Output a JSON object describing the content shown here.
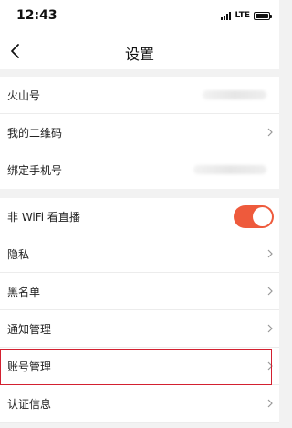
{
  "status_bar": {
    "time": "12:43",
    "network": "LTE",
    "icons": [
      "signal-icon",
      "battery-icon"
    ]
  },
  "nav": {
    "title": "设置",
    "back_icon": "chevron-left-icon"
  },
  "group1": {
    "rows": [
      {
        "label": "火山号"
      },
      {
        "label": "我的二维码"
      },
      {
        "label": "绑定手机号"
      }
    ]
  },
  "group2": {
    "rows": [
      {
        "label": "非 WiFi 看直播",
        "toggle": true
      },
      {
        "label": "隐私"
      },
      {
        "label": "黑名单"
      },
      {
        "label": "通知管理"
      },
      {
        "label": "账号管理"
      },
      {
        "label": "认证信息"
      }
    ]
  },
  "colors": {
    "toggle_on": "#ee5a3c",
    "highlight": "#d32030",
    "background": "#f2f2f2"
  }
}
